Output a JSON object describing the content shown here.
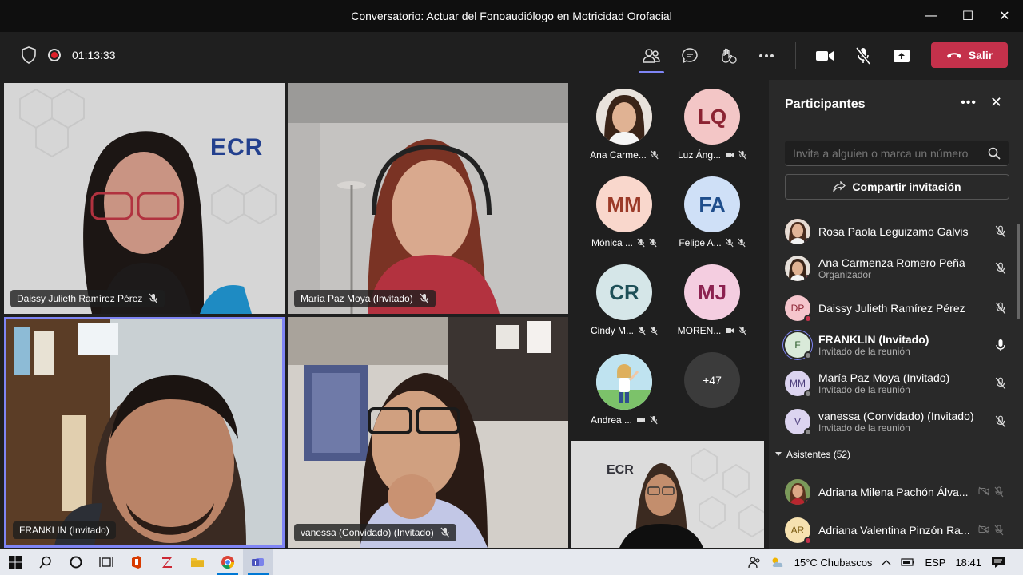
{
  "window": {
    "title": "Conversatorio: Actuar del Fonoaudiólogo en Motricidad Orofacial",
    "minimize": "—",
    "maximize": "☐",
    "close": "✕"
  },
  "toolbar": {
    "timer": "01:13:33",
    "leave_label": "Salir"
  },
  "videos": [
    {
      "name": "Daissy Julieth Ramírez Pérez",
      "logo": "ECR"
    },
    {
      "name": "María Paz Moya (Invitado)"
    },
    {
      "name": "FRANKLIN (Invitado)"
    },
    {
      "name": "vanessa (Convidado) (Invitado)"
    }
  ],
  "roster_tiles": [
    {
      "initials": "",
      "label": "Ana Carme...",
      "bg": "#8a6a55"
    },
    {
      "initials": "LQ",
      "label": "Luz Áng...",
      "bg": "#f3c6c6",
      "fg": "#8b2332"
    },
    {
      "initials": "MM",
      "label": "Mónica ...",
      "bg": "#f9d7cc",
      "fg": "#9b3a28"
    },
    {
      "initials": "FA",
      "label": "Felipe A...",
      "bg": "#cfe0f7",
      "fg": "#1f4e8c"
    },
    {
      "initials": "CR",
      "label": "Cindy M...",
      "bg": "#d5e6e8",
      "fg": "#1e5058"
    },
    {
      "initials": "MJ",
      "label": "MOREN...",
      "bg": "#f4cde0",
      "fg": "#8c2150"
    },
    {
      "initials": "",
      "label": "Andrea ...",
      "bg": "#e7f4e4"
    },
    {
      "initials": "+47",
      "label": "",
      "bg": "#3b3b3b",
      "fg": "#ffffff"
    }
  ],
  "self_view": {
    "logo": "ECR"
  },
  "panel": {
    "title": "Participantes",
    "search_placeholder": "Invita a alguien o marca un número",
    "share_label": "Compartir invitación",
    "participants": [
      {
        "name": "Rosa Paola Leguizamo Galvis",
        "sub": "",
        "initials": "",
        "bg": "#b58a78",
        "status": "#c4314b",
        "mic": "muted"
      },
      {
        "name": "Ana Carmenza Romero Peña",
        "sub": "Organizador",
        "initials": "",
        "bg": "#8a6a55",
        "status": "#c4314b",
        "mic": "muted"
      },
      {
        "name": "Daissy Julieth Ramírez Pérez",
        "sub": "",
        "initials": "DP",
        "bg": "#f5c5cc",
        "status": "#c4314b",
        "mic": "muted"
      },
      {
        "name": "FRANKLIN (Invitado)",
        "sub": "Invitado de la reunión",
        "initials": "F",
        "bg": "#d9ead9",
        "status": "#8a8a8a",
        "mic": "on"
      },
      {
        "name": "María Paz Moya (Invitado)",
        "sub": "Invitado de la reunión",
        "initials": "MM",
        "bg": "#dcd4f0",
        "status": "#8a8a8a",
        "mic": "muted"
      },
      {
        "name": "vanessa (Convidado) (Invitado)",
        "sub": "Invitado de la reunión",
        "initials": "V",
        "bg": "#dcd4f0",
        "status": "#8a8a8a",
        "mic": "muted"
      }
    ],
    "attendees_header": "Asistentes (52)",
    "attendees": [
      {
        "name": "Adriana Milena Pachón Álva...",
        "initials": "",
        "bg": "#a87660",
        "status": "#c4314b"
      },
      {
        "name": "Adriana Valentina Pinzón Ra...",
        "initials": "AR",
        "bg": "#f6e1b0",
        "status": "#c4314b"
      }
    ]
  },
  "taskbar": {
    "weather": "15°C  Chubascos",
    "lang": "ESP",
    "time": "18:41"
  }
}
